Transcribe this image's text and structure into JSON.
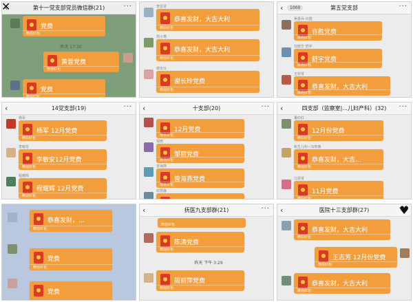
{
  "common": {
    "envelope_sub": "微信红包",
    "back_glyph": "‹",
    "more_glyph": "···"
  },
  "panels": [
    {
      "header": "第十一党支部党员微信群(21)",
      "messages": [
        {
          "sender": "",
          "title": "党费"
        },
        {
          "sender": "",
          "title": "黄晋党费"
        },
        {
          "sender": "",
          "title": "党费"
        }
      ],
      "timestamp": "昨天 17:20"
    },
    {
      "header": "",
      "messages": [
        {
          "sender": "李显琴",
          "title": "恭喜发财，大吉大利"
        },
        {
          "sender": "周小莺",
          "title": "恭喜发财，大吉大利"
        },
        {
          "sender": "谢长玲",
          "title": "谢长玲党费"
        }
      ]
    },
    {
      "header": "第五党支部",
      "unread": "1000",
      "messages": [
        {
          "sender": "吴勇兵-许胜",
          "title": "许胜党费"
        },
        {
          "sender": "刘丽华 舒宇",
          "title": "舒宇党费"
        },
        {
          "sender": "王钦琴",
          "title": "恭喜发财，大吉大利"
        }
      ]
    },
    {
      "header": "14党支部(19)",
      "messages": [
        {
          "sender": "杨军",
          "title": "杨军 12月党费"
        },
        {
          "sender": "李敏安",
          "title": "李敏安12月党费"
        },
        {
          "sender": "程耀辉",
          "title": "程耀辉 12月党费"
        }
      ]
    },
    {
      "header": "十支部(20)",
      "messages": [
        {
          "sender": "",
          "title": "12月党费"
        },
        {
          "sender": "邹丽",
          "title": "邹丽党费"
        },
        {
          "sender": "曾海燕",
          "title": "曾海燕党费"
        },
        {
          "sender": "邓慧静",
          "title": ""
        }
      ]
    },
    {
      "header": "四支部（监察室|...儿妇产科）(32)",
      "messages": [
        {
          "sender": "董红红",
          "title": "12月份党费"
        },
        {
          "sender": "新生儿科~冯奇楠",
          "title": "恭喜发财，大吉..."
        },
        {
          "sender": "江恩琴",
          "title": "11月党费"
        }
      ]
    },
    {
      "header": "",
      "messages": [
        {
          "sender": "",
          "title": "恭喜发财，..."
        },
        {
          "sender": "",
          "title": "党费"
        },
        {
          "sender": "",
          "title": "党费"
        }
      ]
    },
    {
      "header": "抚医九支部群(21)",
      "messages": [
        {
          "sender": "",
          "title": ""
        },
        {
          "sender": "",
          "title": "陈涛党费"
        },
        {
          "sender": "",
          "title": "周丽萍党费"
        }
      ],
      "timestamp": "昨天 下午 3:29"
    },
    {
      "header": "医院十三支部群(27)",
      "messages": [
        {
          "sender": "",
          "title": "恭喜发财，大吉大利"
        },
        {
          "sender": "",
          "title": "王志芳 12月份党费"
        },
        {
          "sender": "",
          "title": "恭喜发财，大吉大利"
        }
      ]
    }
  ]
}
